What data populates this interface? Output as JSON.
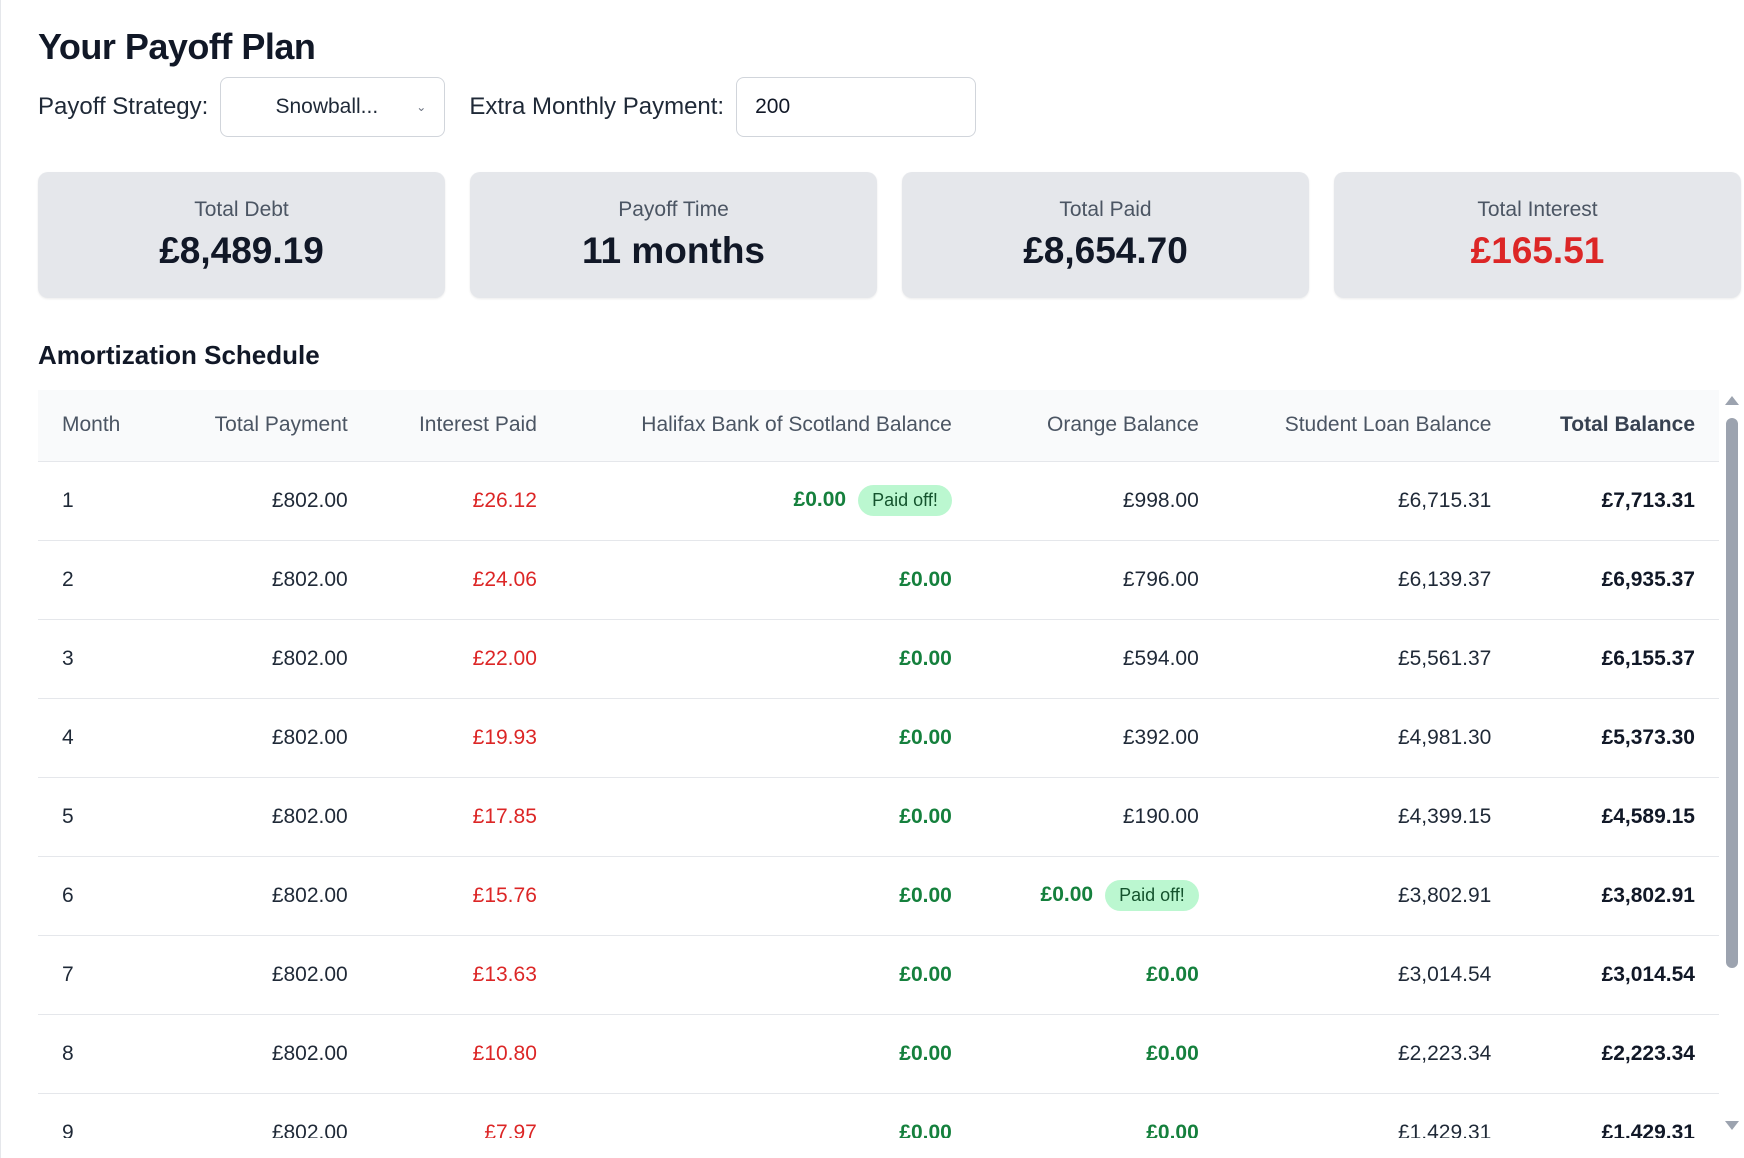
{
  "title": "Your Payoff Plan",
  "controls": {
    "strategy_label": "Payoff Strategy:",
    "strategy_value": "Snowball...",
    "extra_label": "Extra Monthly Payment:",
    "extra_value": "200"
  },
  "summary": [
    {
      "label": "Total Debt",
      "value": "£8,489.19"
    },
    {
      "label": "Payoff Time",
      "value": "11 months"
    },
    {
      "label": "Total Paid",
      "value": "£8,654.70"
    },
    {
      "label": "Total Interest",
      "value": "£165.51"
    }
  ],
  "schedule": {
    "title": "Amortization Schedule",
    "headers": [
      "Month",
      "Total Payment",
      "Interest Paid",
      "Halifax Bank of Scotland Balance",
      "Orange Balance",
      "Student Loan Balance",
      "Total Balance"
    ],
    "paid_off_label": "Paid off!",
    "rows": [
      {
        "month": "1",
        "payment": "£802.00",
        "interest": "£26.12",
        "halifax": "£0.00",
        "halifax_paid_off": true,
        "orange": "£998.00",
        "orange_paid_off": false,
        "student": "£6,715.31",
        "total": "£7,713.31"
      },
      {
        "month": "2",
        "payment": "£802.00",
        "interest": "£24.06",
        "halifax": "£0.00",
        "halifax_paid_off": false,
        "orange": "£796.00",
        "orange_paid_off": false,
        "student": "£6,139.37",
        "total": "£6,935.37"
      },
      {
        "month": "3",
        "payment": "£802.00",
        "interest": "£22.00",
        "halifax": "£0.00",
        "halifax_paid_off": false,
        "orange": "£594.00",
        "orange_paid_off": false,
        "student": "£5,561.37",
        "total": "£6,155.37"
      },
      {
        "month": "4",
        "payment": "£802.00",
        "interest": "£19.93",
        "halifax": "£0.00",
        "halifax_paid_off": false,
        "orange": "£392.00",
        "orange_paid_off": false,
        "student": "£4,981.30",
        "total": "£5,373.30"
      },
      {
        "month": "5",
        "payment": "£802.00",
        "interest": "£17.85",
        "halifax": "£0.00",
        "halifax_paid_off": false,
        "orange": "£190.00",
        "orange_paid_off": false,
        "student": "£4,399.15",
        "total": "£4,589.15"
      },
      {
        "month": "6",
        "payment": "£802.00",
        "interest": "£15.76",
        "halifax": "£0.00",
        "halifax_paid_off": false,
        "orange": "£0.00",
        "orange_paid_off": true,
        "student": "£3,802.91",
        "total": "£3,802.91"
      },
      {
        "month": "7",
        "payment": "£802.00",
        "interest": "£13.63",
        "halifax": "£0.00",
        "halifax_paid_off": false,
        "orange": "£0.00",
        "orange_paid_off": false,
        "student": "£3,014.54",
        "total": "£3,014.54"
      },
      {
        "month": "8",
        "payment": "£802.00",
        "interest": "£10.80",
        "halifax": "£0.00",
        "halifax_paid_off": false,
        "orange": "£0.00",
        "orange_paid_off": false,
        "student": "£2,223.34",
        "total": "£2,223.34"
      },
      {
        "month": "9",
        "payment": "£802.00",
        "interest": "£7.97",
        "halifax": "£0.00",
        "halifax_paid_off": false,
        "orange": "£0.00",
        "orange_paid_off": false,
        "student": "£1,429.31",
        "total": "£1,429.31"
      }
    ]
  },
  "colors": {
    "interest": "#dc2626",
    "zero_balance": "#15803d",
    "badge_bg": "#bbf7d0",
    "card_bg": "#e5e7eb"
  }
}
